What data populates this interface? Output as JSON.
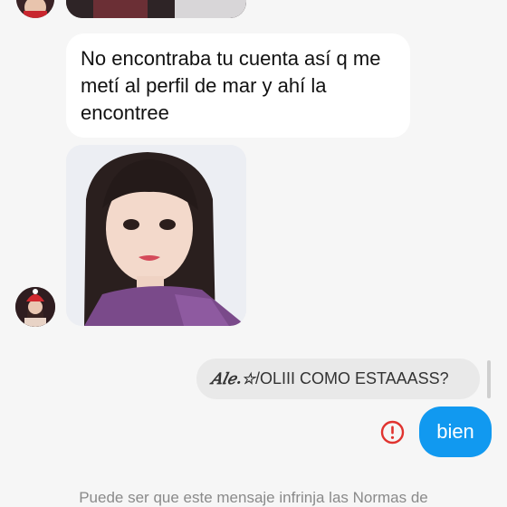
{
  "messages": {
    "incoming_text": "No encontraba tu cuenta así q me metí al perfil de mar y ahí la encontree",
    "reply_quote": {
      "name": "𝐴𝑙𝑒.☆",
      "text": "/OLIII COMO ESTAAASS?"
    },
    "outgoing_text": "bien"
  },
  "icons": {
    "send_error": "exclamation-circle-icon"
  },
  "colors": {
    "outgoing_bubble": "#1199f0",
    "error_red": "#e0332f",
    "incoming_bubble": "#ffffff",
    "background": "#f6f6f6"
  },
  "footer": {
    "notice": "Puede ser que este mensaje infrinja las Normas de"
  }
}
